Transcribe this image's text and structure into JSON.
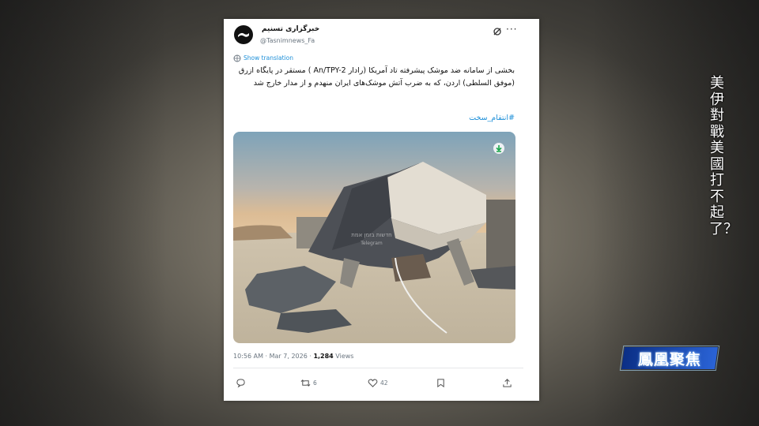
{
  "post": {
    "account_name": "خبرگزاری تسنیم",
    "handle": "@Tasnimnews_Fa",
    "show_translation": "Show translation",
    "text": "بخشی از سامانه ضد موشک پیشرفته تاد آمریکا (رادار An/TPY-2 ) مستقر در پایگاه ازرق (موفق السلطی) اردن، که به ضرب آتش موشک‌های ایران منهدم و از مدار خارج شد",
    "hashtag": "#انتقام_سخت",
    "time": "10:56 AM",
    "date": "Mar 7, 2026",
    "views_count": "1,284",
    "views_label": "Views",
    "retweets": "6",
    "likes": "42",
    "image_watermark_1": "חדשות בזמן אמת",
    "image_watermark_2": "Telegram"
  },
  "icons": {
    "avatar": "tasnim-logo",
    "grok": "grok-icon",
    "more": "more-icon",
    "translate": "globe-icon",
    "download": "download-icon",
    "reply": "reply-icon",
    "retweet": "retweet-icon",
    "like": "heart-icon",
    "bookmark": "bookmark-icon",
    "share": "share-icon"
  },
  "overlay": {
    "side_caption": "美伊對戰 美國打不起了？",
    "channel_logo": "鳳凰聚焦"
  },
  "colors": {
    "link": "#1d8fd8",
    "logo_blue": "#1a4bb8"
  }
}
